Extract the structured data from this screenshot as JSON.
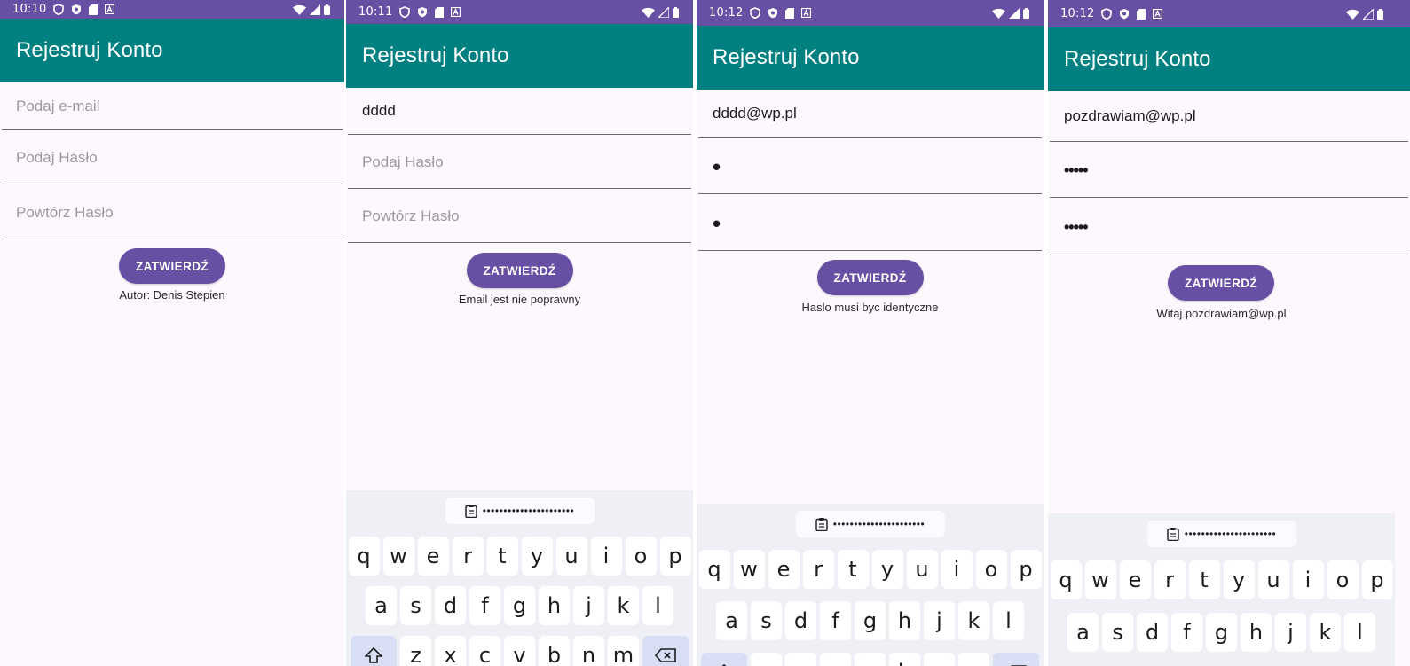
{
  "common": {
    "app_title": "Rejestruj Konto",
    "submit_label": "ZATWIERDŹ",
    "placeholders": {
      "email": "Podaj e-mail",
      "password": "Podaj Hasło",
      "repeat": "Powtórz Hasło"
    },
    "clipboard_text": "••••••••••••••••••••••",
    "keyboard_rows": [
      [
        "q",
        "w",
        "e",
        "r",
        "t",
        "y",
        "u",
        "i",
        "o",
        "p"
      ],
      [
        "a",
        "s",
        "d",
        "f",
        "g",
        "h",
        "j",
        "k",
        "l"
      ],
      [
        "z",
        "x",
        "c",
        "v",
        "b",
        "n",
        "m"
      ]
    ],
    "colors": {
      "status_bar": "#6750a4",
      "app_bar": "#008080",
      "button": "#6750a4",
      "background": "#fdf7fe"
    }
  },
  "screens": [
    {
      "time": "10:10",
      "email_value": "",
      "password_value": "",
      "repeat_value": "",
      "message": "Autor: Denis Stepien"
    },
    {
      "time": "10:11",
      "email_value": "dddd",
      "password_value": "",
      "repeat_value": "",
      "message": "Email jest nie poprawny"
    },
    {
      "time": "10:12",
      "email_value": "dddd@wp.pl",
      "password_value": "•",
      "repeat_value": "•",
      "message": "Haslo musi byc identyczne"
    },
    {
      "time": "10:12",
      "email_value": "pozdrawiam@wp.pl",
      "password_value": "•••••",
      "repeat_value": "•••••",
      "message": "Witaj pozdrawiam@wp.pl"
    }
  ]
}
